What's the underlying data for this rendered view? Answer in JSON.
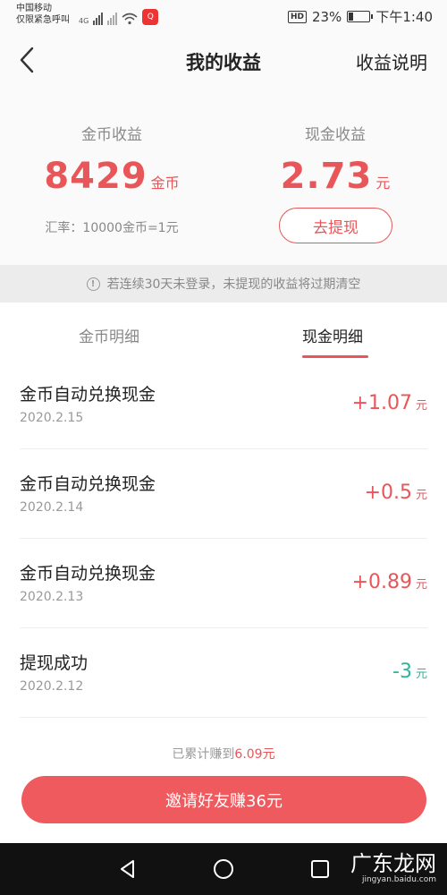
{
  "status_bar": {
    "carrier": "中国移动",
    "emergency": "仅限紧急呼叫",
    "network": "4G",
    "app_badge": "Q",
    "hd": "HD",
    "battery": "23%",
    "battery_level": 0.23,
    "time": "下午1:40"
  },
  "nav": {
    "title": "我的收益",
    "explain": "收益说明"
  },
  "summary": {
    "coin_label": "金币收益",
    "coin_amount": "8429",
    "coin_unit": "金币",
    "cash_label": "现金收益",
    "cash_amount": "2.73",
    "cash_unit": "元",
    "rate": "汇率：10000金币=1元",
    "withdraw": "去提现"
  },
  "notice": {
    "text": "若连续30天未登录，未提现的收益将过期清空"
  },
  "tabs": [
    {
      "label": "金币明细"
    },
    {
      "label": "现金明细"
    }
  ],
  "records": [
    {
      "title": "金币自动兑换现金",
      "date": "2020.2.15",
      "amount": "+1.07",
      "unit": "元"
    },
    {
      "title": "金币自动兑换现金",
      "date": "2020.2.14",
      "amount": "+0.5",
      "unit": "元"
    },
    {
      "title": "金币自动兑换现金",
      "date": "2020.2.13",
      "amount": "+0.89",
      "unit": "元"
    },
    {
      "title": "提现成功",
      "date": "2020.2.12",
      "amount": "-3",
      "unit": "元"
    }
  ],
  "footer": {
    "earned_prefix": "已累计赚到",
    "earned_value": "6.09元",
    "invite": "邀请好友赚36元"
  },
  "watermark": {
    "text": "广东龙网",
    "sub": "jingyan.baidu.com"
  },
  "colors": {
    "accent": "#e95659",
    "negative": "#2bb59a"
  }
}
